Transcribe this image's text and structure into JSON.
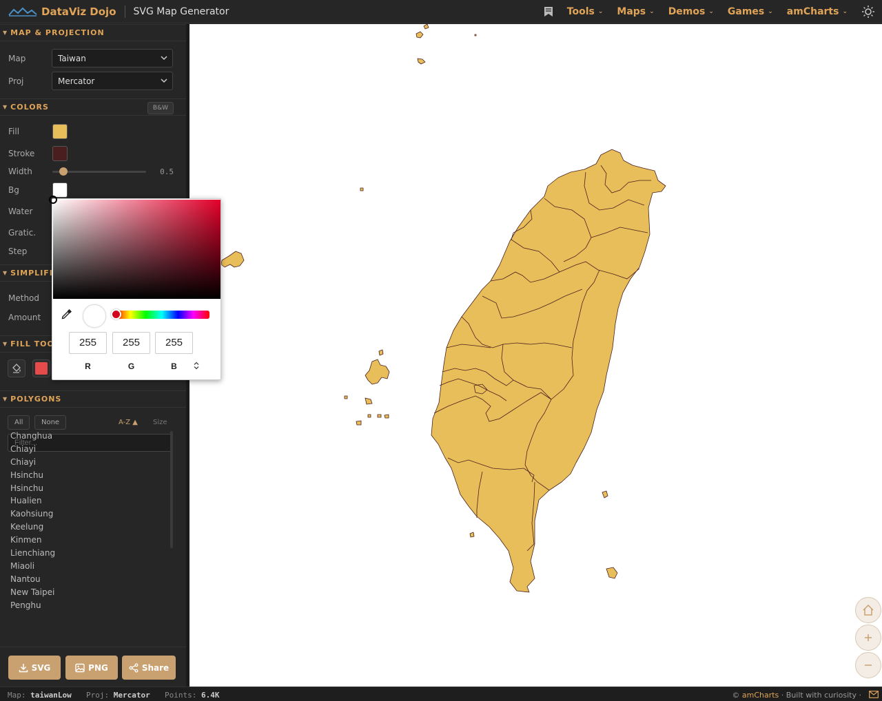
{
  "topbar": {
    "brand": "DataViz Dojo",
    "app_title": "SVG Map Generator",
    "nav": [
      {
        "label": "Tools"
      },
      {
        "label": "Maps"
      },
      {
        "label": "Demos"
      },
      {
        "label": "Games"
      },
      {
        "label": "amCharts"
      }
    ]
  },
  "sections": {
    "map_projection": "MAP & PROJECTION",
    "colors": "COLORS",
    "simplification": "SIMPLIFICA",
    "fill_tool": "FILL TOOL",
    "polygons": "POLYGONS"
  },
  "map_projection": {
    "map_label": "Map",
    "map_value": "Taiwan",
    "proj_label": "Proj",
    "proj_value": "Mercator"
  },
  "colors": {
    "bw_button": "B&W",
    "fill_label": "Fill",
    "fill_color": "#E8BE5A",
    "stroke_label": "Stroke",
    "stroke_color": "#4A1E1E",
    "width_label": "Width",
    "width_value": "0.5",
    "width_fraction": 0.12,
    "bg_label": "Bg",
    "bg_color": "#FFFFFF",
    "water_label": "Water",
    "graticule_label": "Gratic.",
    "step_label": "Step"
  },
  "simplification": {
    "method_label": "Method",
    "amount_label": "Amount"
  },
  "fill_tool": {
    "active_color": "#E54B4B"
  },
  "polygons": {
    "all_button": "All",
    "none_button": "None",
    "sort_label": "A-Z ▲",
    "size_label": "Size",
    "filter_placeholder": "Filter...",
    "items": [
      "Changhua",
      "Chiayi",
      "Chiayi",
      "Hsinchu",
      "Hsinchu",
      "Hualien",
      "Kaohsiung",
      "Keelung",
      "Kinmen",
      "Lienchiang",
      "Miaoli",
      "Nantou",
      "New Taipei",
      "Penghu"
    ]
  },
  "actions": {
    "svg": "SVG",
    "png": "PNG",
    "share": "Share"
  },
  "color_picker": {
    "r": "255",
    "g": "255",
    "b": "255",
    "r_label": "R",
    "g_label": "G",
    "b_label": "B",
    "hue_color": "#E3002A"
  },
  "status": {
    "map_label": "Map:",
    "map_value": "taiwanLow",
    "proj_label": "Proj:",
    "proj_value": "Mercator",
    "points_label": "Points:",
    "points_value": "6.4K",
    "credit_prefix": "©",
    "credit_link": "amCharts",
    "credit_suffix": "· Built with curiosity ·"
  },
  "map_style": {
    "fill": "#E8BE5A",
    "stroke": "#4A1E1E"
  }
}
